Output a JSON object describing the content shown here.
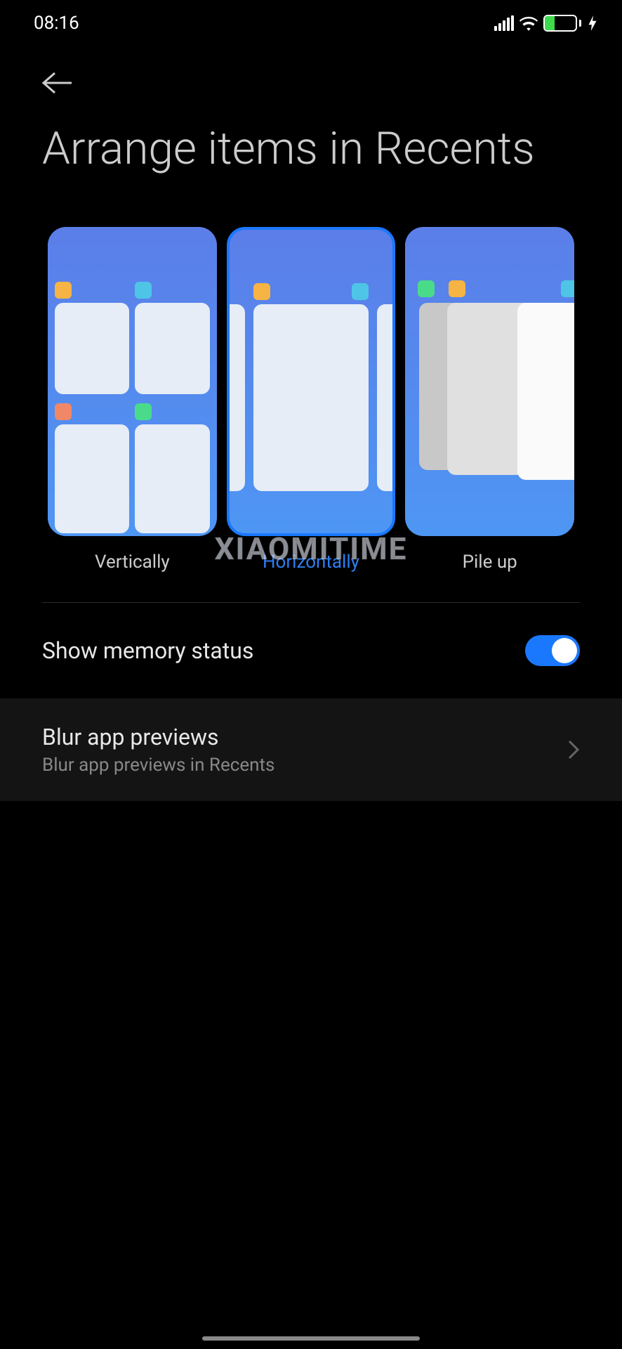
{
  "status": {
    "time": "08:16",
    "battery_level": "32"
  },
  "page": {
    "title": "Arrange items in Recents"
  },
  "options": {
    "vertical": "Vertically",
    "horizontal": "Horizontally",
    "pileup": "Pile up"
  },
  "settings": {
    "memory": {
      "label": "Show memory status"
    },
    "blur": {
      "label": "Blur app previews",
      "sublabel": "Blur app previews in Recents"
    }
  },
  "watermark": "XIAOMITIME"
}
